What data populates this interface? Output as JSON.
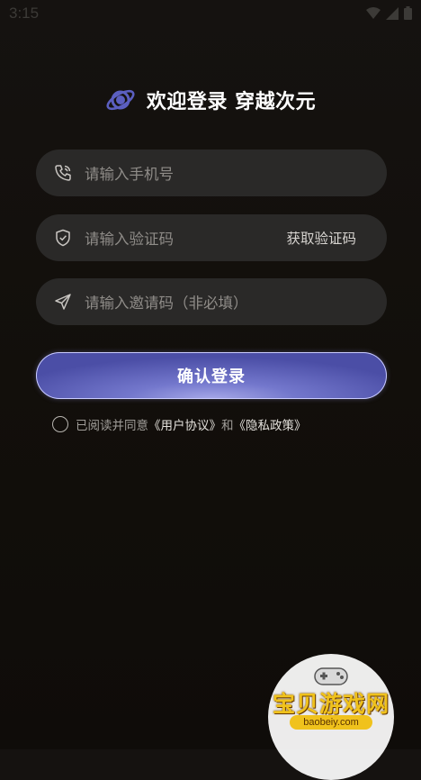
{
  "status_bar": {
    "time": "3:15"
  },
  "header": {
    "title": "欢迎登录 穿越次元"
  },
  "form": {
    "phone_placeholder": "请输入手机号",
    "code_placeholder": "请输入验证码",
    "get_code_label": "获取验证码",
    "invite_placeholder": "请输入邀请码（非必填）"
  },
  "login_button": {
    "label": "确认登录"
  },
  "agreement": {
    "prefix": "已阅读并同意",
    "user_agreement": "《用户协议》",
    "and": "和",
    "privacy_policy": "《隐私政策》"
  },
  "watermark": {
    "text": "宝贝游戏网",
    "url": "baobeiy.com"
  },
  "colors": {
    "accent": "#6f73c9",
    "field_bg": "#2a2928",
    "background": "#13100c"
  }
}
